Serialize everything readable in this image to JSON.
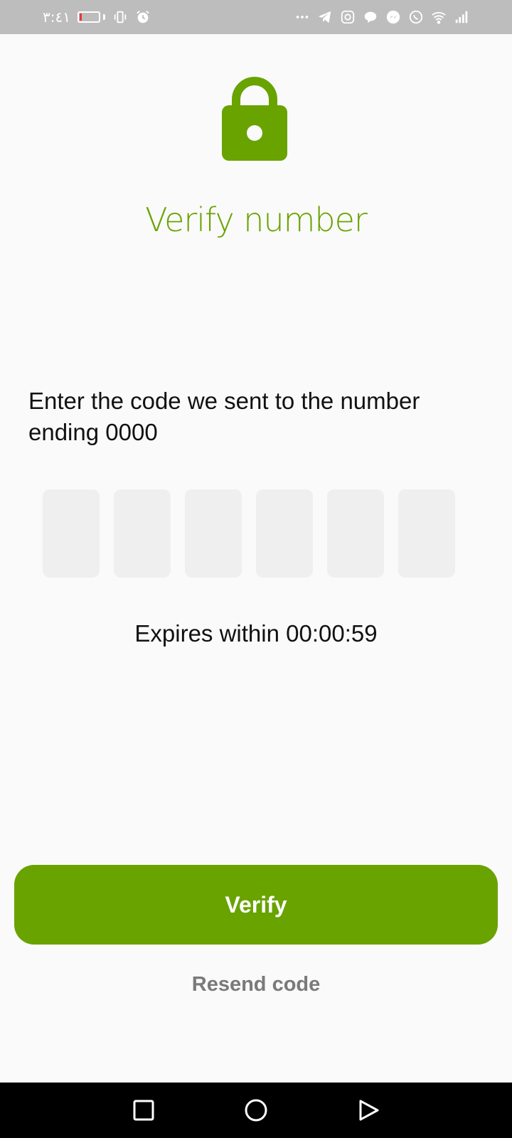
{
  "status_bar": {
    "time": "٣:٤١",
    "battery_color": "#e53935",
    "left_icons": [
      "vibrate-icon",
      "alarm-icon"
    ],
    "right_icons": [
      "more-icon",
      "telegram-icon",
      "instagram-icon",
      "chat-bubble-icon",
      "messenger-icon",
      "whatsapp-icon",
      "wifi-icon",
      "signal-icon"
    ]
  },
  "header": {
    "icon": "lock-icon",
    "title": "Verify number"
  },
  "main": {
    "instructions": "Enter the code we sent to the number ending 0000",
    "code_fields": [
      {
        "value": ""
      },
      {
        "value": ""
      },
      {
        "value": ""
      },
      {
        "value": ""
      },
      {
        "value": ""
      },
      {
        "value": ""
      }
    ],
    "expires_text": "Expires within 00:00:59"
  },
  "actions": {
    "verify_label": "Verify",
    "resend_label": "Resend code"
  },
  "colors": {
    "accent": "#68a300",
    "resend": "#7a7a7a",
    "code_box_bg": "#efefef"
  },
  "nav_bar": {
    "buttons": [
      "recent-apps-icon",
      "home-icon",
      "back-icon"
    ]
  }
}
